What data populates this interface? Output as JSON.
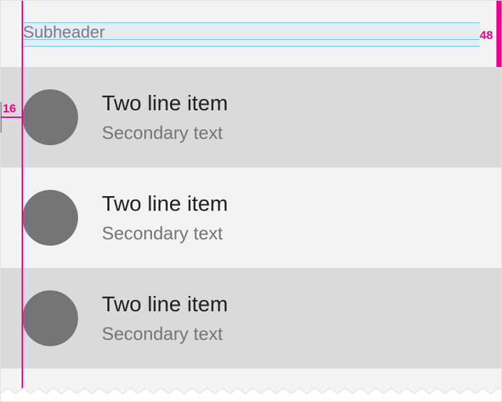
{
  "subheader": {
    "label": "Subheader"
  },
  "list": {
    "items": [
      {
        "primary": "Two line item",
        "secondary": "Secondary text"
      },
      {
        "primary": "Two line item",
        "secondary": "Secondary text"
      },
      {
        "primary": "Two line item",
        "secondary": "Secondary text"
      }
    ]
  },
  "annotations": {
    "subheader_height": "48",
    "keyline_margin": "16"
  },
  "colors": {
    "annotation": "#ec008c",
    "guide": "#6ec3ea",
    "row_shaded": "#dadada",
    "row_plain": "#f3f3f3",
    "avatar": "#757575",
    "primary_text": "#212121",
    "secondary_text": "#757575"
  }
}
